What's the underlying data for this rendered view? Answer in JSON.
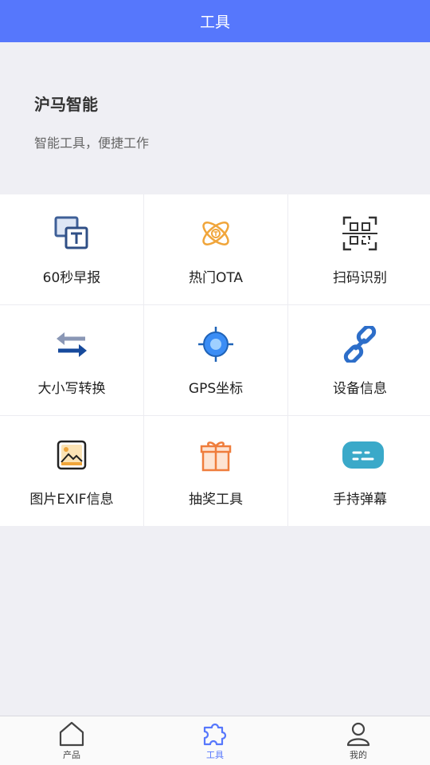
{
  "header": {
    "title": "工具"
  },
  "hero": {
    "brand": "沪马智能",
    "slogan": "智能工具，便捷工作"
  },
  "tools": [
    {
      "label": "60秒早报",
      "icon": "text-image-icon"
    },
    {
      "label": "热门OTA",
      "icon": "atom-icon"
    },
    {
      "label": "扫码识别",
      "icon": "qr-scan-icon"
    },
    {
      "label": "大小写转换",
      "icon": "swap-arrows-icon"
    },
    {
      "label": "GPS坐标",
      "icon": "crosshair-icon"
    },
    {
      "label": "设备信息",
      "icon": "link-icon"
    },
    {
      "label": "图片EXIF信息",
      "icon": "picture-icon"
    },
    {
      "label": "抽奖工具",
      "icon": "gift-icon"
    },
    {
      "label": "手持弹幕",
      "icon": "chat-bubble-icon"
    }
  ],
  "tabbar": {
    "items": [
      {
        "label": "产品",
        "icon": "home-icon",
        "active": false
      },
      {
        "label": "工具",
        "icon": "puzzle-icon",
        "active": true
      },
      {
        "label": "我的",
        "icon": "user-icon",
        "active": false
      }
    ]
  },
  "colors": {
    "primary": "#5677fc",
    "background": "#efeff4"
  }
}
